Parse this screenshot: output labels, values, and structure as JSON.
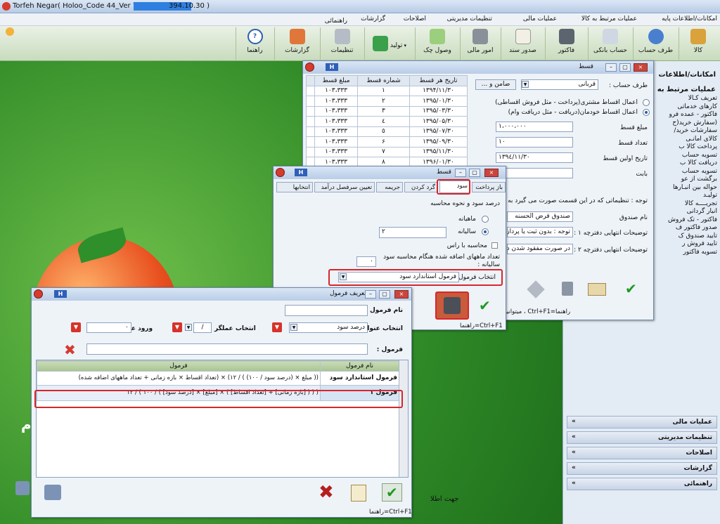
{
  "app": {
    "title": "Torfeh Negar( Holoo_Code 44_Ver 7.77_",
    "title_suffix": "394.10.30 )"
  },
  "menu": [
    "امکانات/اطلاعات پایه",
    "عملیات مرتبط به کالا",
    "عملیات مالی",
    "تنظیمات مدیریتی",
    "اصلاحات",
    "گزارشات",
    "راهنمائی"
  ],
  "toolbar": [
    {
      "label": "کالا",
      "icon": "box-icon"
    },
    {
      "label": "طرف حساب",
      "icon": "person-icon"
    },
    {
      "label": "حساب بانکی",
      "icon": "bank-card-icon"
    },
    {
      "label": "فاکتور",
      "icon": "calculator-icon"
    },
    {
      "label": "صدور سند",
      "icon": "document-pen-icon"
    },
    {
      "label": "امور مالی",
      "icon": "cash-register-icon"
    },
    {
      "label": "وصول چک",
      "icon": "check-money-icon"
    },
    {
      "label": "تولید",
      "icon": "cube-icon"
    },
    {
      "label": "تنظیمات",
      "icon": "tools-icon"
    },
    {
      "label": "گزارشات",
      "icon": "report-icon"
    },
    {
      "label": "راهنما",
      "icon": "help-icon"
    }
  ],
  "rightpanel": {
    "header": "امکانات/اطلاعات",
    "section": "عملیات مرتبط به",
    "items": [
      "تعریف کـالا",
      "کارهای خدماتی",
      "فاکتور - عمده فرو",
      "(سفارش خرید(ح",
      "سفارشات خرید/",
      "کالای امانـی",
      "پرداخت کالا ب",
      "تسویه حساب",
      "دریافت کالا ب",
      "تسویه حساب",
      "برگشت از عو",
      "حواله بین انبـارها",
      "تولیـد",
      "تجریــــه کالا",
      "انبار گردانی",
      "فاکتور - تک فروش",
      "صدور فاکتور ف",
      "تایید صندوق ک",
      "تایید فروش ر",
      "تسویه فاکتور"
    ],
    "bars": [
      "عملیات مالی",
      "تنظیمات مدیریتی",
      "اصلاحات",
      "گزارشات",
      "راهنمائی"
    ]
  },
  "desk": {
    "side_text": "جهت اطلا",
    "edge_text": "م"
  },
  "qest": {
    "title": "قسط",
    "headers": [
      "تاریخ هر قسط",
      "شماره قسط",
      "مبلغ قسط"
    ],
    "rows": [
      [
        "۱۳۹۴/۱۱/۳۰",
        "۱",
        "۱۰۳،۳۳۳"
      ],
      [
        "۱۳۹۵/۰۱/۳۰",
        "۲",
        "۱۰۳،۳۳۳"
      ],
      [
        "۱۳۹۵/۰۳/۳۰",
        "۳",
        "۱۰۳،۳۳۳"
      ],
      [
        "۱۳۹۵/۰۵/۳۰",
        "٤",
        "۱۰۳،۳۳۳"
      ],
      [
        "۱۳۹۵/۰۷/۳۰",
        "٥",
        "۱۰۳،۳۳۳"
      ],
      [
        "۱۳۹۵/۰۹/۳۰",
        "۶",
        "۱۰۳،۳۳۳"
      ],
      [
        "۱۳۹۵/۱۱/۳۰",
        "۷",
        "۱۰۳،۳۳۳"
      ],
      [
        "۱۳۹۶/۰۱/۳۰",
        "۸",
        "۱۰۳،۳۳۳"
      ]
    ],
    "party_label": "طرف حساب :",
    "party_value": "قربانی",
    "guarantor": "ضامن و ...",
    "radio1": "اعمال اقساط مشتری(پرداخت - مثل فروش اقساطی)",
    "radio2": "اعمال اقساط خودمان(دریافت - مثل دریافت وام)",
    "amount_label": "مبلغ قسط",
    "amount_value": "۱،۰۰۰،۰۰۰",
    "count_label": "تعداد قسط",
    "count_value": "۱۰",
    "first_label": "تاریخ اولین قسط",
    "first_value": "۱۳۹٤/۱۱/۳۰",
    "babat_label": "بابت",
    "note": "توجه : تنظیماتی که در این قسمت صورت می گیرد به",
    "fund_label": "نام صندوق",
    "fund_value": "صندوق قرض الحسنه",
    "desc1_label": "توضیحات انتهایی دفترچه ۱ :",
    "desc1_value": "توجه : بدون ثبت یا پرداز",
    "desc2_label": "توضیحات انتهایی دفترچه ۲ :",
    "desc2_value": "در صورت مفقود شدن دف",
    "status": "راهنما=Ctrl+F1 ، میتوانید مبلغ و تاریخ اقساط را تغییر د"
  },
  "sood": {
    "title": "قسط",
    "tabs": [
      "باز پرداخت",
      "سود",
      "گرد کردن",
      "جریمه",
      "تعیین سرفصل درآمد",
      "انتخابها"
    ],
    "heading": "درصد سود و نحوه محاسبه",
    "monthly": "ماهیانه",
    "yearly": "سالیانه",
    "yearly_value": "۲",
    "ras": "محاسبه با راس",
    "added_label": "تعداد ماههای اضافه شده هنگام محاسبه سود سالیانه :",
    "added_value": "۰",
    "formula_label": "انتخاب فرمول",
    "formula_value": "فرمول استاندارد سود",
    "status": "راهنما=Ctrl+F1"
  },
  "formula": {
    "title": "تعریف فرمول",
    "name_label": "نام فرمول",
    "title_label": "انتخاب عنوان",
    "title_value": "درصد سود",
    "op_label": "انتخاب عملگر",
    "op_value": "/",
    "num_label": "ورود عدد",
    "num_value": "۰",
    "formula_label": "فرمول :",
    "col_name": "نام فرمول",
    "col_formula": "فرمول",
    "rows": [
      {
        "name": "فرمول استاندارد سود",
        "formula": "(( مبلغ × (درصد سود / ۱۰۰) ) / ۱۲) × (تعداد اقساط × بازه زمانی + تعداد ماههای اضافه شده)"
      },
      {
        "name": "فرمول ۱",
        "formula": "( ( ( [بازه زمانی] + [تعداد اقساط] ) × [مبلغ] × [درصد سود] ) / ۱۰۰ ) / ۱۲"
      }
    ],
    "status": "راهنما=Ctrl+F1"
  },
  "colors": {
    "desktop": "#3a8a2c",
    "highlight": "#d8262b",
    "ok": "#1e9a21"
  }
}
